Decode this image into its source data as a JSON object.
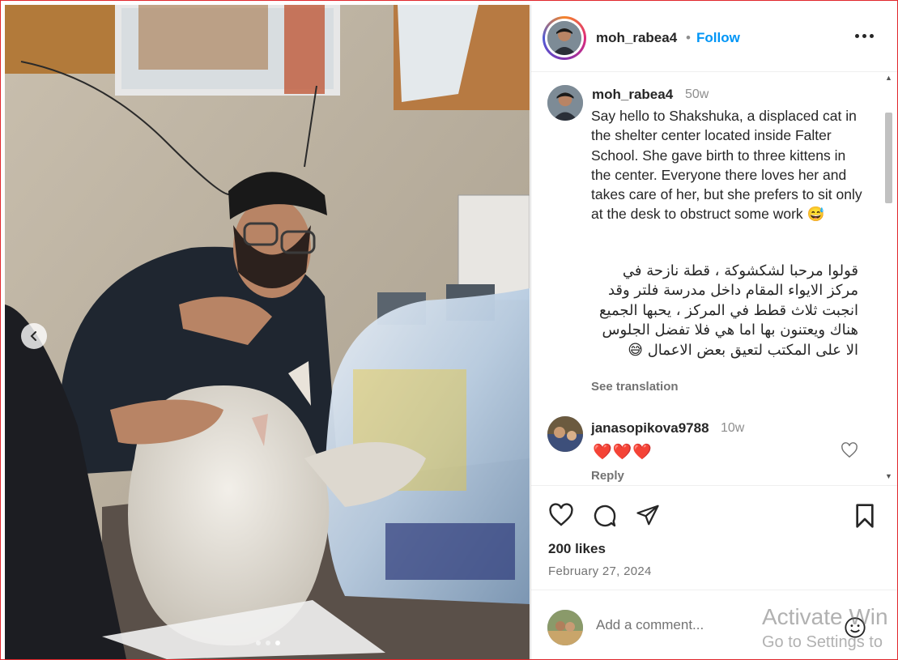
{
  "post": {
    "photo_description": "",
    "carousel": {
      "total": 3,
      "active": 3
    }
  },
  "header": {
    "username": "moh_rabea4",
    "separator": "•",
    "follow_label": "Follow"
  },
  "caption": {
    "username": "moh_rabea4",
    "time": "50w",
    "text_en": "Say hello to Shakshuka, a displaced cat in the shelter center located inside Falter School. She gave birth to three kittens in the center. Everyone there loves her and takes care of her, but she prefers to sit only at the desk to obstruct some work 😅",
    "text_ar": "قولوا مرحبا لشكشوكة ، قطة نازحة في مركز الايواء المقام داخل مدرسة فلتر وقد انجبت ثلاث قطط في المركز ، يحبها الجميع هناك ويعتنون بها اما هي فلا تفضل الجلوس الا على المكتب لتعيق بعض الاعمال 😅",
    "see_translation": "See translation"
  },
  "comment": {
    "username": "janasopikova9788",
    "time": "10w",
    "text": "❤️❤️❤️",
    "reply_label": "Reply"
  },
  "engagement": {
    "likes": "200 likes",
    "date": "February 27, 2024"
  },
  "add_comment": {
    "placeholder": "Add a comment..."
  },
  "watermark": {
    "line1": "Activate Win",
    "line2": "Go to Settings to"
  },
  "colors": {
    "accent": "#0095f6",
    "heart": "#e01b24",
    "frame": "#e0262b"
  },
  "icons": [
    "chevron-left-icon",
    "more-icon",
    "heart-icon",
    "comment-icon",
    "share-icon",
    "save-icon",
    "emoji-icon"
  ]
}
